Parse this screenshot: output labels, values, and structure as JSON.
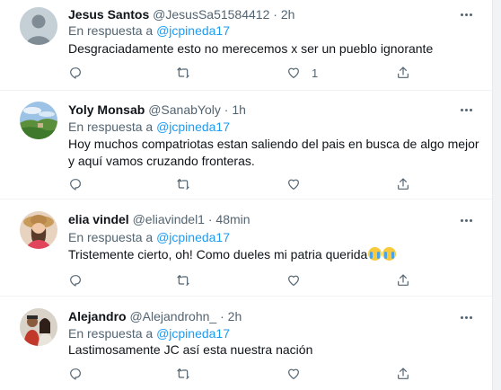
{
  "reply_prefix": "En respuesta a",
  "tweets": [
    {
      "name": "Jesus Santos",
      "handle": "@JesusSa51584412",
      "time": "2h",
      "mention": "@jcpineda17",
      "text": "Desgraciadamente esto no merecemos x ser un pueblo ignorante",
      "likes": "1",
      "avatar_icon": "default-user-avatar"
    },
    {
      "name": "Yoly Monsab",
      "handle": "@SanabYoly",
      "time": "1h",
      "mention": "@jcpineda17",
      "text": "Hoy muchos compatriotas estan saliendo del pais en busca de algo mejor y aquí vamos cruzando fronteras.",
      "likes": "",
      "avatar_icon": "landscape-avatar"
    },
    {
      "name": "elia vindel",
      "handle": "@eliavindel1",
      "time": "48min",
      "mention": "@jcpineda17",
      "text": "Tristemente cierto, oh! Como dueles mi patria querida",
      "emoji_icon": "loudly-crying-face-emoji",
      "likes": "",
      "avatar_icon": "woman-hat-avatar"
    },
    {
      "name": "Alejandro",
      "handle": "@Alejandrohn_",
      "time": "2h",
      "mention": "@jcpineda17",
      "text": "Lastimosamente JC así esta nuestra nación",
      "likes": "",
      "avatar_icon": "couple-photo-avatar"
    }
  ],
  "colors": {
    "text": "#0f1419",
    "secondary": "#536471",
    "link": "#1d9bf0",
    "divider": "#eff3f4"
  }
}
